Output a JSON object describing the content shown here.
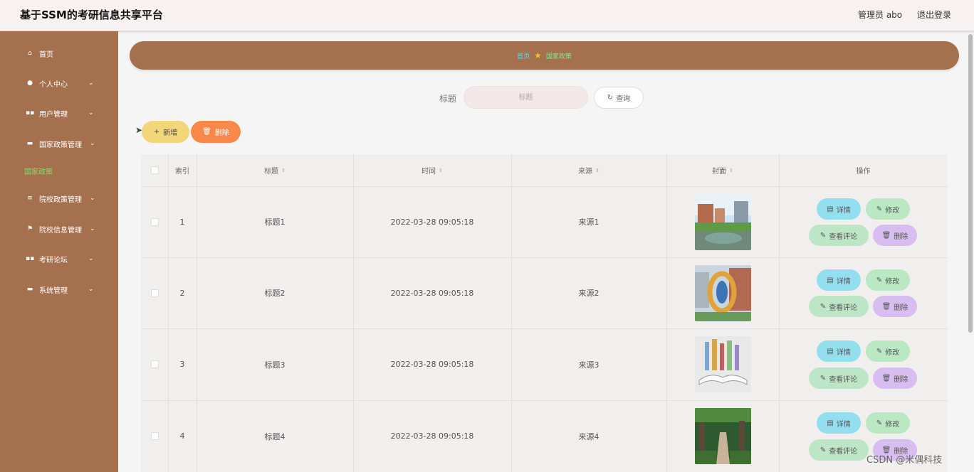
{
  "header": {
    "title": "基于SSM的考研信息共享平台",
    "admin_label": "管理员 abo",
    "logout_label": "退出登录"
  },
  "sidebar": {
    "items": [
      {
        "label": "首页",
        "icon": "home-icon",
        "glyph": "⌂",
        "has_arrow": false
      },
      {
        "label": "个人中心",
        "icon": "user-icon",
        "glyph": "●",
        "has_arrow": true
      },
      {
        "label": "用户管理",
        "icon": "grid-icon",
        "glyph": "▪▪",
        "has_arrow": true
      },
      {
        "label": "国家政策管理",
        "icon": "monitor-icon",
        "glyph": "▬",
        "has_arrow": true
      },
      {
        "label": "院校政策管理",
        "icon": "list-icon",
        "glyph": "≡",
        "has_arrow": true
      },
      {
        "label": "院校信息管理",
        "icon": "flag-icon",
        "glyph": "⚑",
        "has_arrow": true
      },
      {
        "label": "考研论坛",
        "icon": "grid-icon",
        "glyph": "▪▪",
        "has_arrow": true
      },
      {
        "label": "系统管理",
        "icon": "chat-icon",
        "glyph": "▬",
        "has_arrow": true
      }
    ],
    "active_sub": "国家政策"
  },
  "breadcrumb": {
    "home": "首页",
    "current": "国家政策"
  },
  "search": {
    "label": "标题",
    "placeholder": "标题",
    "button_label": "查询"
  },
  "actions": {
    "add_label": "新增",
    "delete_label": "删除"
  },
  "table": {
    "columns": [
      "索引",
      "标题",
      "时间",
      "来源",
      "封面",
      "操作"
    ],
    "rows": [
      {
        "index": "1",
        "title": "标题1",
        "time": "2022-03-28 09:05:18",
        "source": "来源1",
        "cover": "campus-lake-image"
      },
      {
        "index": "2",
        "title": "标题2",
        "time": "2022-03-28 09:05:18",
        "source": "来源2",
        "cover": "sculpture-image"
      },
      {
        "index": "3",
        "title": "标题3",
        "time": "2022-03-28 09:05:18",
        "source": "来源3",
        "cover": "open-book-image"
      },
      {
        "index": "4",
        "title": "标题4",
        "time": "2022-03-28 09:05:18",
        "source": "来源4",
        "cover": "tree-path-image"
      }
    ],
    "ops": {
      "detail": "详情",
      "edit": "修改",
      "comments": "查看评论",
      "delete": "删除"
    }
  },
  "watermark": "CSDN @米偶科技",
  "colors": {
    "sidebar": "#a5704d",
    "breadcrumb_home": "#66d4ea",
    "breadcrumb_current": "#8ee08f",
    "add": "#f2d77a",
    "delete": "#f8894a",
    "detail": "#93dff0",
    "edit": "#b9e8c3",
    "comment": "#bde6c6",
    "row_delete": "#d8bdf0"
  }
}
